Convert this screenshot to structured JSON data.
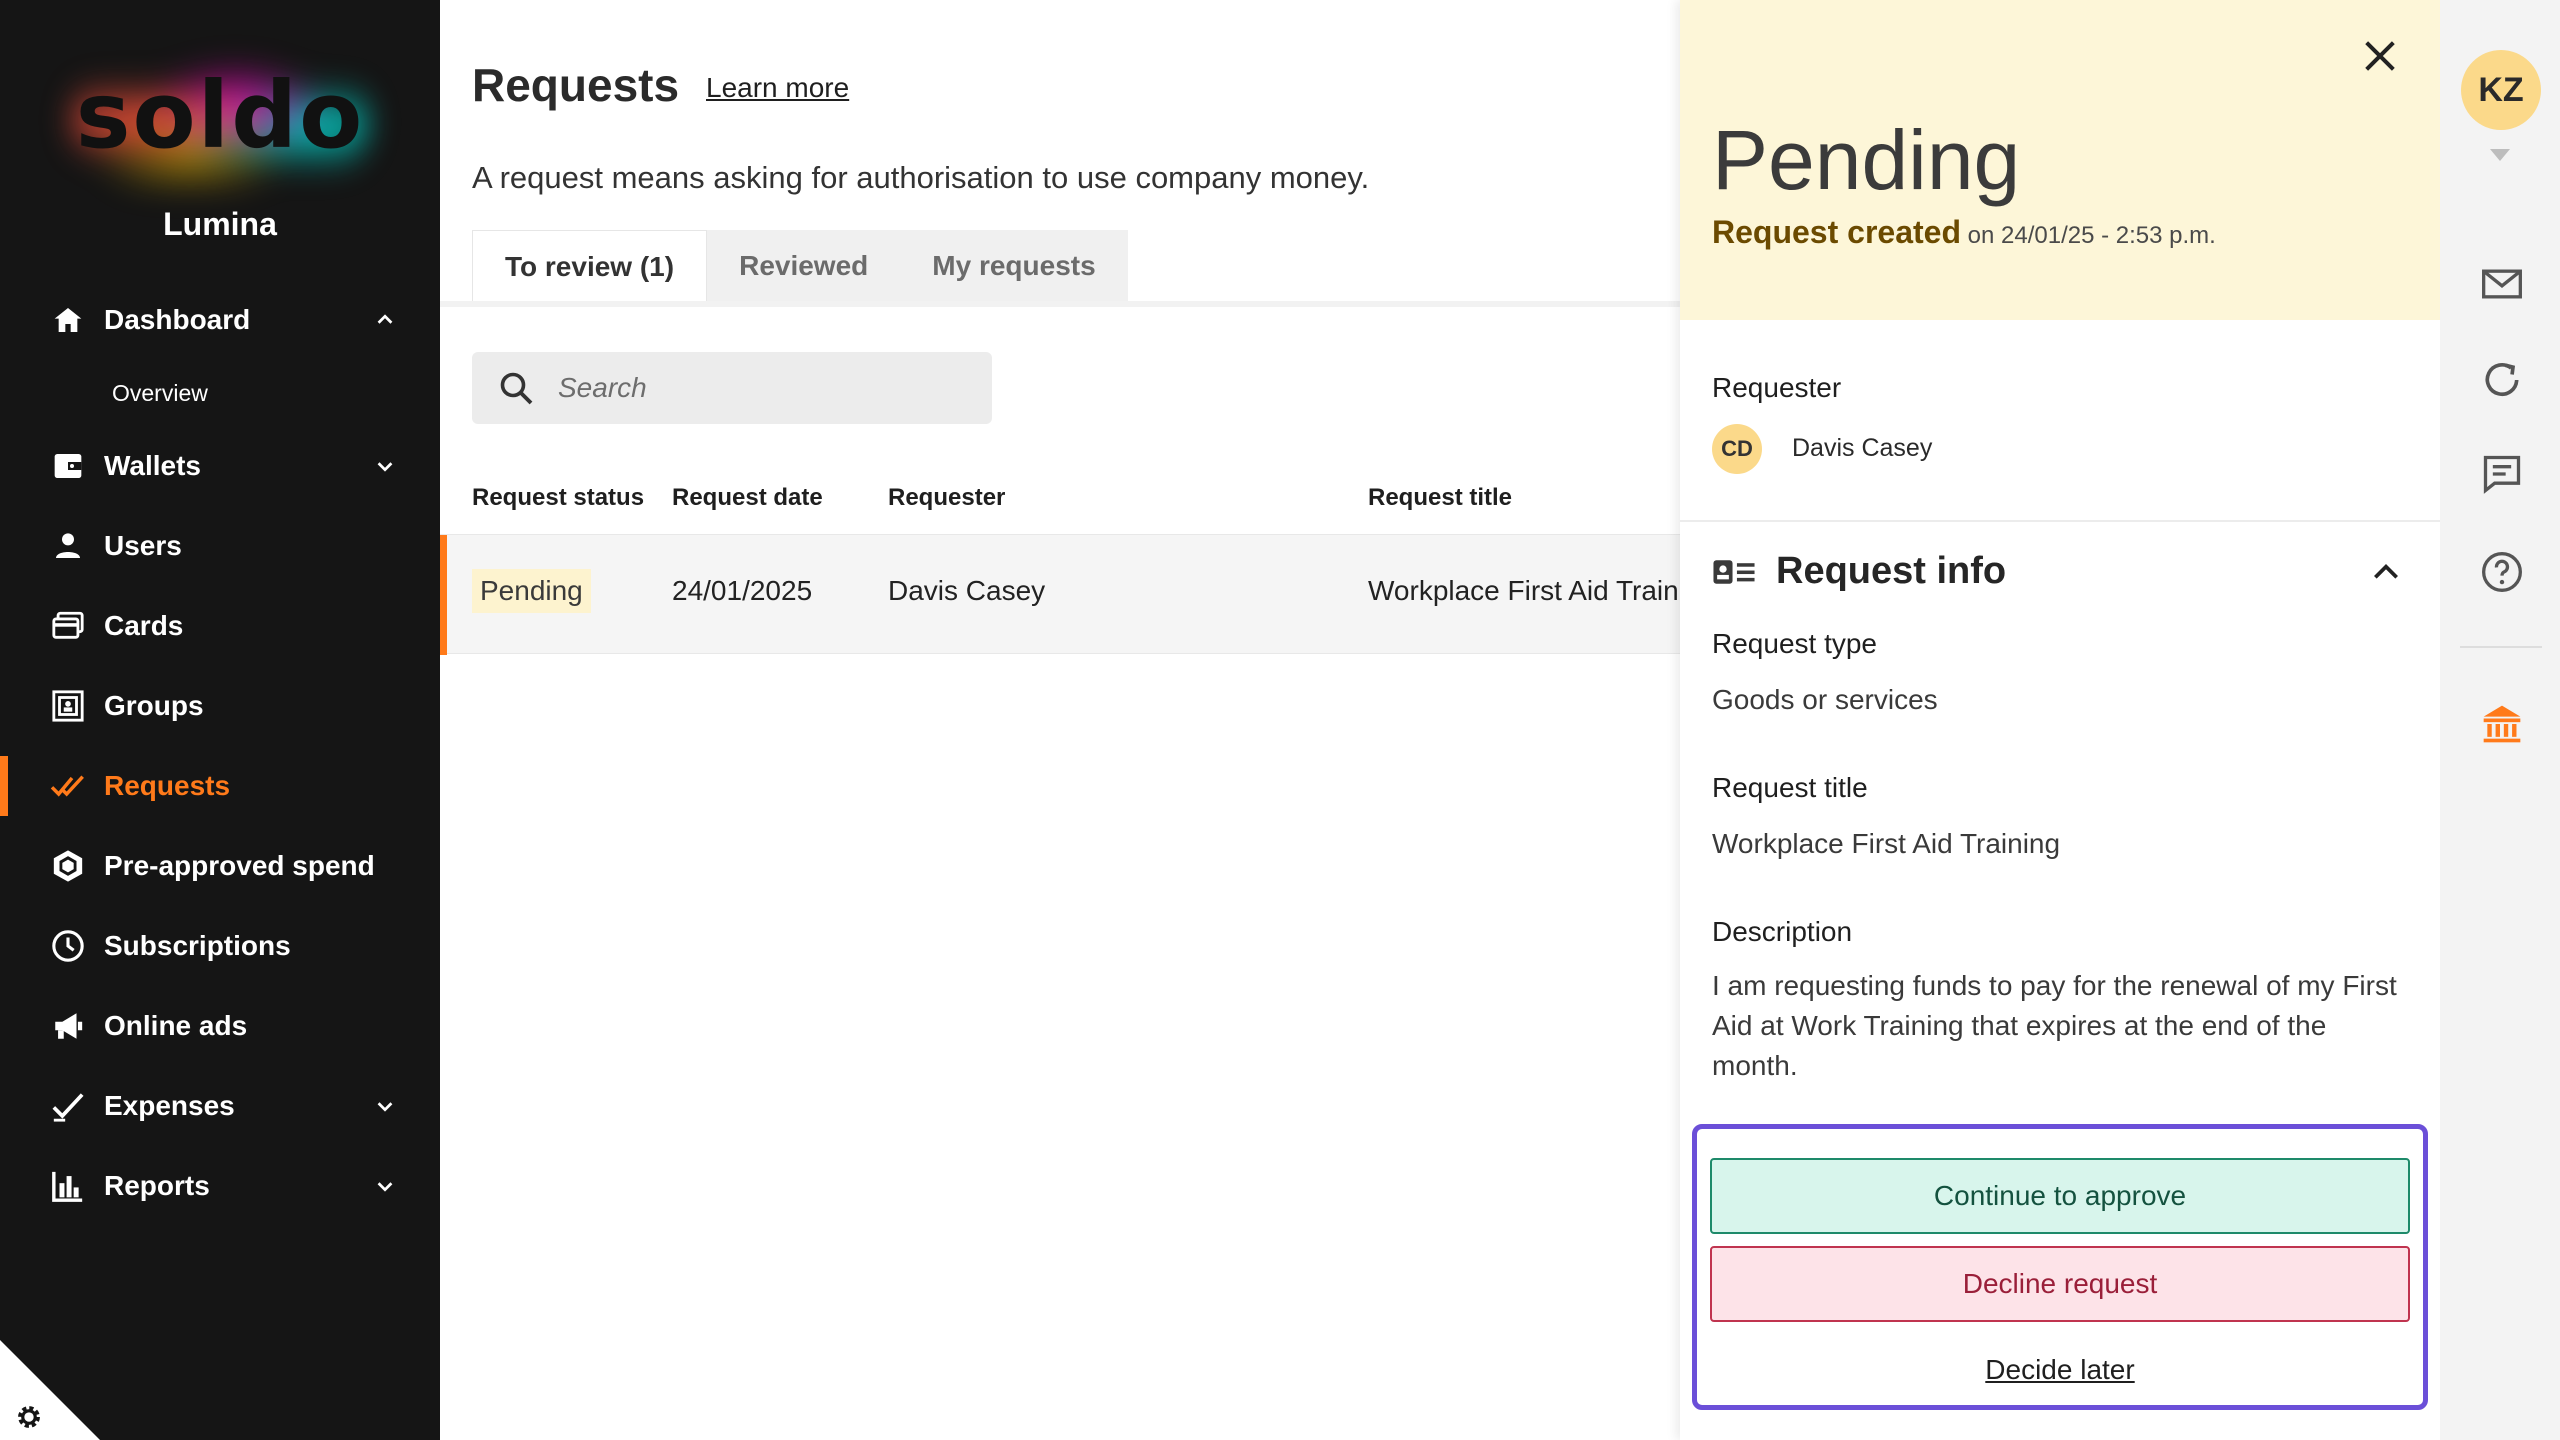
{
  "sidebar": {
    "logo_text": "soldo",
    "org_name": "Lumina",
    "items": [
      {
        "label": "Dashboard",
        "icon": "home-icon"
      },
      {
        "label": "Overview"
      },
      {
        "label": "Wallets",
        "icon": "wallet-icon"
      },
      {
        "label": "Users",
        "icon": "user-icon"
      },
      {
        "label": "Cards",
        "icon": "card-icon"
      },
      {
        "label": "Groups",
        "icon": "groups-icon"
      },
      {
        "label": "Requests",
        "icon": "double-check-icon"
      },
      {
        "label": "Pre-approved spend",
        "icon": "hexagon-check-icon"
      },
      {
        "label": "Subscriptions",
        "icon": "clock-icon"
      },
      {
        "label": "Online ads",
        "icon": "megaphone-icon"
      },
      {
        "label": "Expenses",
        "icon": "check-icon"
      },
      {
        "label": "Reports",
        "icon": "bar-chart-icon"
      }
    ]
  },
  "main": {
    "title": "Requests",
    "learn_more": "Learn more",
    "subtitle": "A request means asking for authorisation to use company money.",
    "tabs": [
      {
        "label": "To review (1)"
      },
      {
        "label": "Reviewed"
      },
      {
        "label": "My requests"
      }
    ],
    "search": {
      "placeholder": "Search"
    },
    "table": {
      "headers": [
        "Request status",
        "Request date",
        "Requester",
        "Request title"
      ],
      "rows": [
        {
          "status": "Pending",
          "date": "24/01/2025",
          "requester": "Davis Casey",
          "title": "Workplace First Aid Traini"
        }
      ]
    }
  },
  "panel": {
    "status_title": "Pending",
    "created_label": "Request created",
    "created_on": "on 24/01/25 - 2:53 p.m.",
    "requester_label": "Requester",
    "requester_initials": "CD",
    "requester_name": "Davis Casey",
    "info_title": "Request info",
    "request_type_label": "Request type",
    "request_type_value": "Goods or services",
    "request_title_label": "Request title",
    "request_title_value": "Workplace First Aid Training",
    "description_label": "Description",
    "description_value": "I am requesting funds to pay for the renewal of my First Aid at Work Training that expires at the end of the month.",
    "approve_label": "Continue to approve",
    "decline_label": "Decline request",
    "later_label": "Decide later"
  },
  "rail": {
    "avatar_initials": "KZ"
  },
  "colors": {
    "sidebar_bg": "#151515",
    "accent": "#ff7a1a",
    "pending_bg": "#fdf6d8",
    "approve_border": "#1e8a6a",
    "decline_border": "#c0344f",
    "focus_frame": "#6b4fd8"
  }
}
